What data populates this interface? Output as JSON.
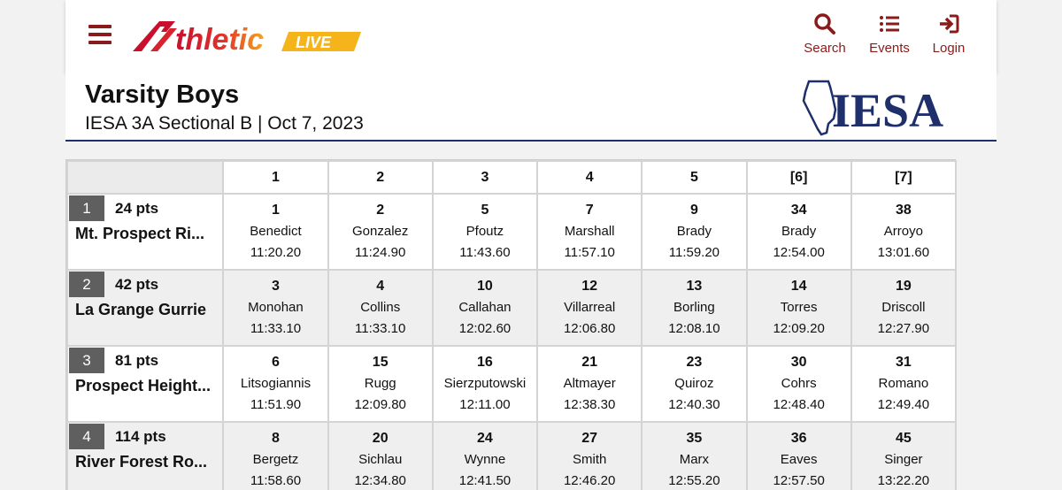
{
  "nav": {
    "search_label": "Search",
    "events_label": "Events",
    "login_label": "Login"
  },
  "logo": {
    "main": "thletic",
    "live": "LIVE"
  },
  "event": {
    "title": "Varsity Boys",
    "subtitle": "IESA 3A Sectional B | Oct 7, 2023",
    "org_logo": "IESA"
  },
  "columns": [
    "1",
    "2",
    "3",
    "4",
    "5",
    "[6]",
    "[7]"
  ],
  "teams": [
    {
      "place": "1",
      "points": "24 pts",
      "name": "Mt. Prospect Ri...",
      "runners": [
        {
          "place": "1",
          "name": "Benedict",
          "time": "11:20.20"
        },
        {
          "place": "2",
          "name": "Gonzalez",
          "time": "11:24.90"
        },
        {
          "place": "5",
          "name": "Pfoutz",
          "time": "11:43.60"
        },
        {
          "place": "7",
          "name": "Marshall",
          "time": "11:57.10"
        },
        {
          "place": "9",
          "name": "Brady",
          "time": "11:59.20"
        },
        {
          "place": "34",
          "name": "Brady",
          "time": "12:54.00"
        },
        {
          "place": "38",
          "name": "Arroyo",
          "time": "13:01.60"
        }
      ]
    },
    {
      "place": "2",
      "points": "42 pts",
      "name": "La Grange Gurrie",
      "runners": [
        {
          "place": "3",
          "name": "Monohan",
          "time": "11:33.10"
        },
        {
          "place": "4",
          "name": "Collins",
          "time": "11:33.10"
        },
        {
          "place": "10",
          "name": "Callahan",
          "time": "12:02.60"
        },
        {
          "place": "12",
          "name": "Villarreal",
          "time": "12:06.80"
        },
        {
          "place": "13",
          "name": "Borling",
          "time": "12:08.10"
        },
        {
          "place": "14",
          "name": "Torres",
          "time": "12:09.20"
        },
        {
          "place": "19",
          "name": "Driscoll",
          "time": "12:27.90"
        }
      ]
    },
    {
      "place": "3",
      "points": "81 pts",
      "name": "Prospect Height...",
      "runners": [
        {
          "place": "6",
          "name": "Litsogiannis",
          "time": "11:51.90"
        },
        {
          "place": "15",
          "name": "Rugg",
          "time": "12:09.80"
        },
        {
          "place": "16",
          "name": "Sierzputowski",
          "time": "12:11.00"
        },
        {
          "place": "21",
          "name": "Altmayer",
          "time": "12:38.30"
        },
        {
          "place": "23",
          "name": "Quiroz",
          "time": "12:40.30"
        },
        {
          "place": "30",
          "name": "Cohrs",
          "time": "12:48.40"
        },
        {
          "place": "31",
          "name": "Romano",
          "time": "12:49.40"
        }
      ]
    },
    {
      "place": "4",
      "points": "114 pts",
      "name": "River Forest Ro...",
      "runners": [
        {
          "place": "8",
          "name": "Bergetz",
          "time": "11:58.60"
        },
        {
          "place": "20",
          "name": "Sichlau",
          "time": "12:34.80"
        },
        {
          "place": "24",
          "name": "Wynne",
          "time": "12:41.50"
        },
        {
          "place": "27",
          "name": "Smith",
          "time": "12:46.20"
        },
        {
          "place": "35",
          "name": "Marx",
          "time": "12:55.20"
        },
        {
          "place": "36",
          "name": "Eaves",
          "time": "12:57.50"
        },
        {
          "place": "45",
          "name": "Singer",
          "time": "13:22.20"
        }
      ]
    }
  ]
}
